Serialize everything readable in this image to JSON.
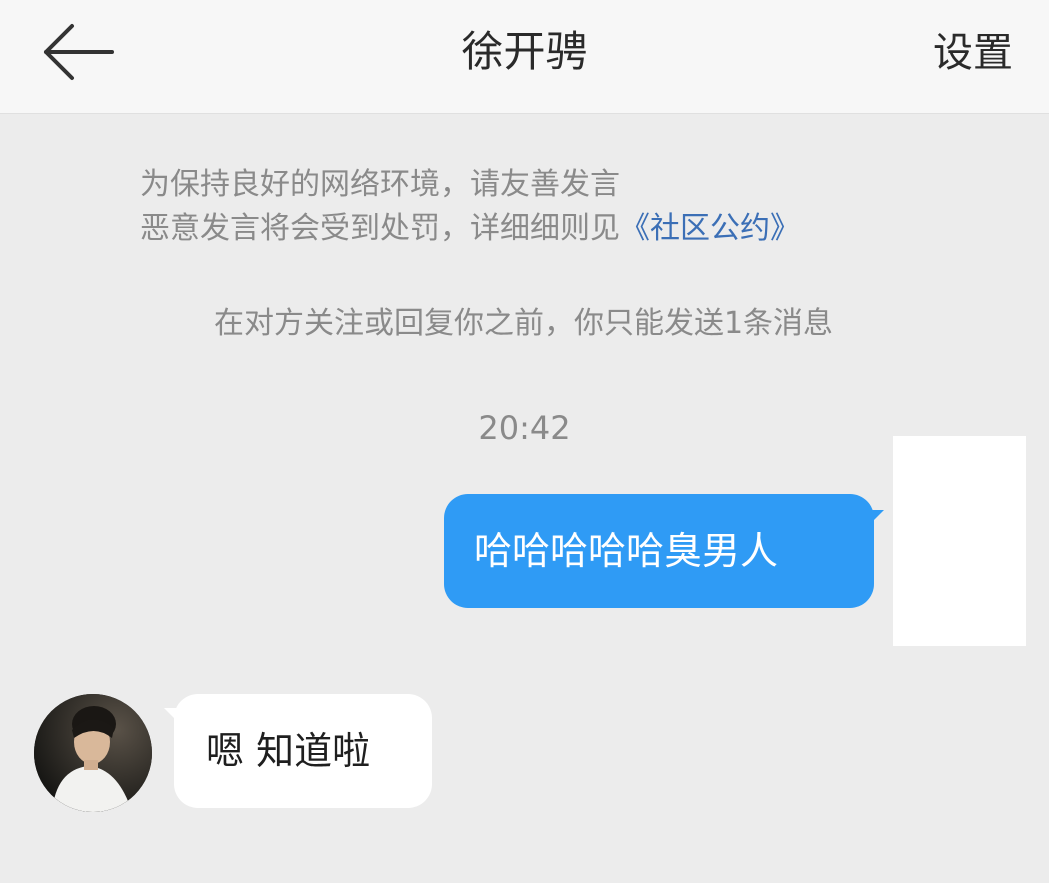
{
  "nav": {
    "back_icon": "arrow-left-icon",
    "title": "徐开骋",
    "settings_label": "设置"
  },
  "notice": {
    "line1": "为保持良好的网络环境，请友善发言",
    "line2_prefix": "恶意发言将会受到处罚，详细细则见",
    "line2_link": "《社区公约》"
  },
  "limit_notice": "在对方关注或回复你之前，你只能发送1条消息",
  "timestamp": "20:42",
  "messages": [
    {
      "direction": "sent",
      "text": "哈哈哈哈哈臭男人"
    },
    {
      "direction": "received",
      "text": "嗯 知道啦"
    }
  ],
  "colors": {
    "sent_bubble": "#2f9bf5",
    "received_bubble": "#ffffff",
    "link": "#3b6fb6",
    "background": "#ececec"
  }
}
